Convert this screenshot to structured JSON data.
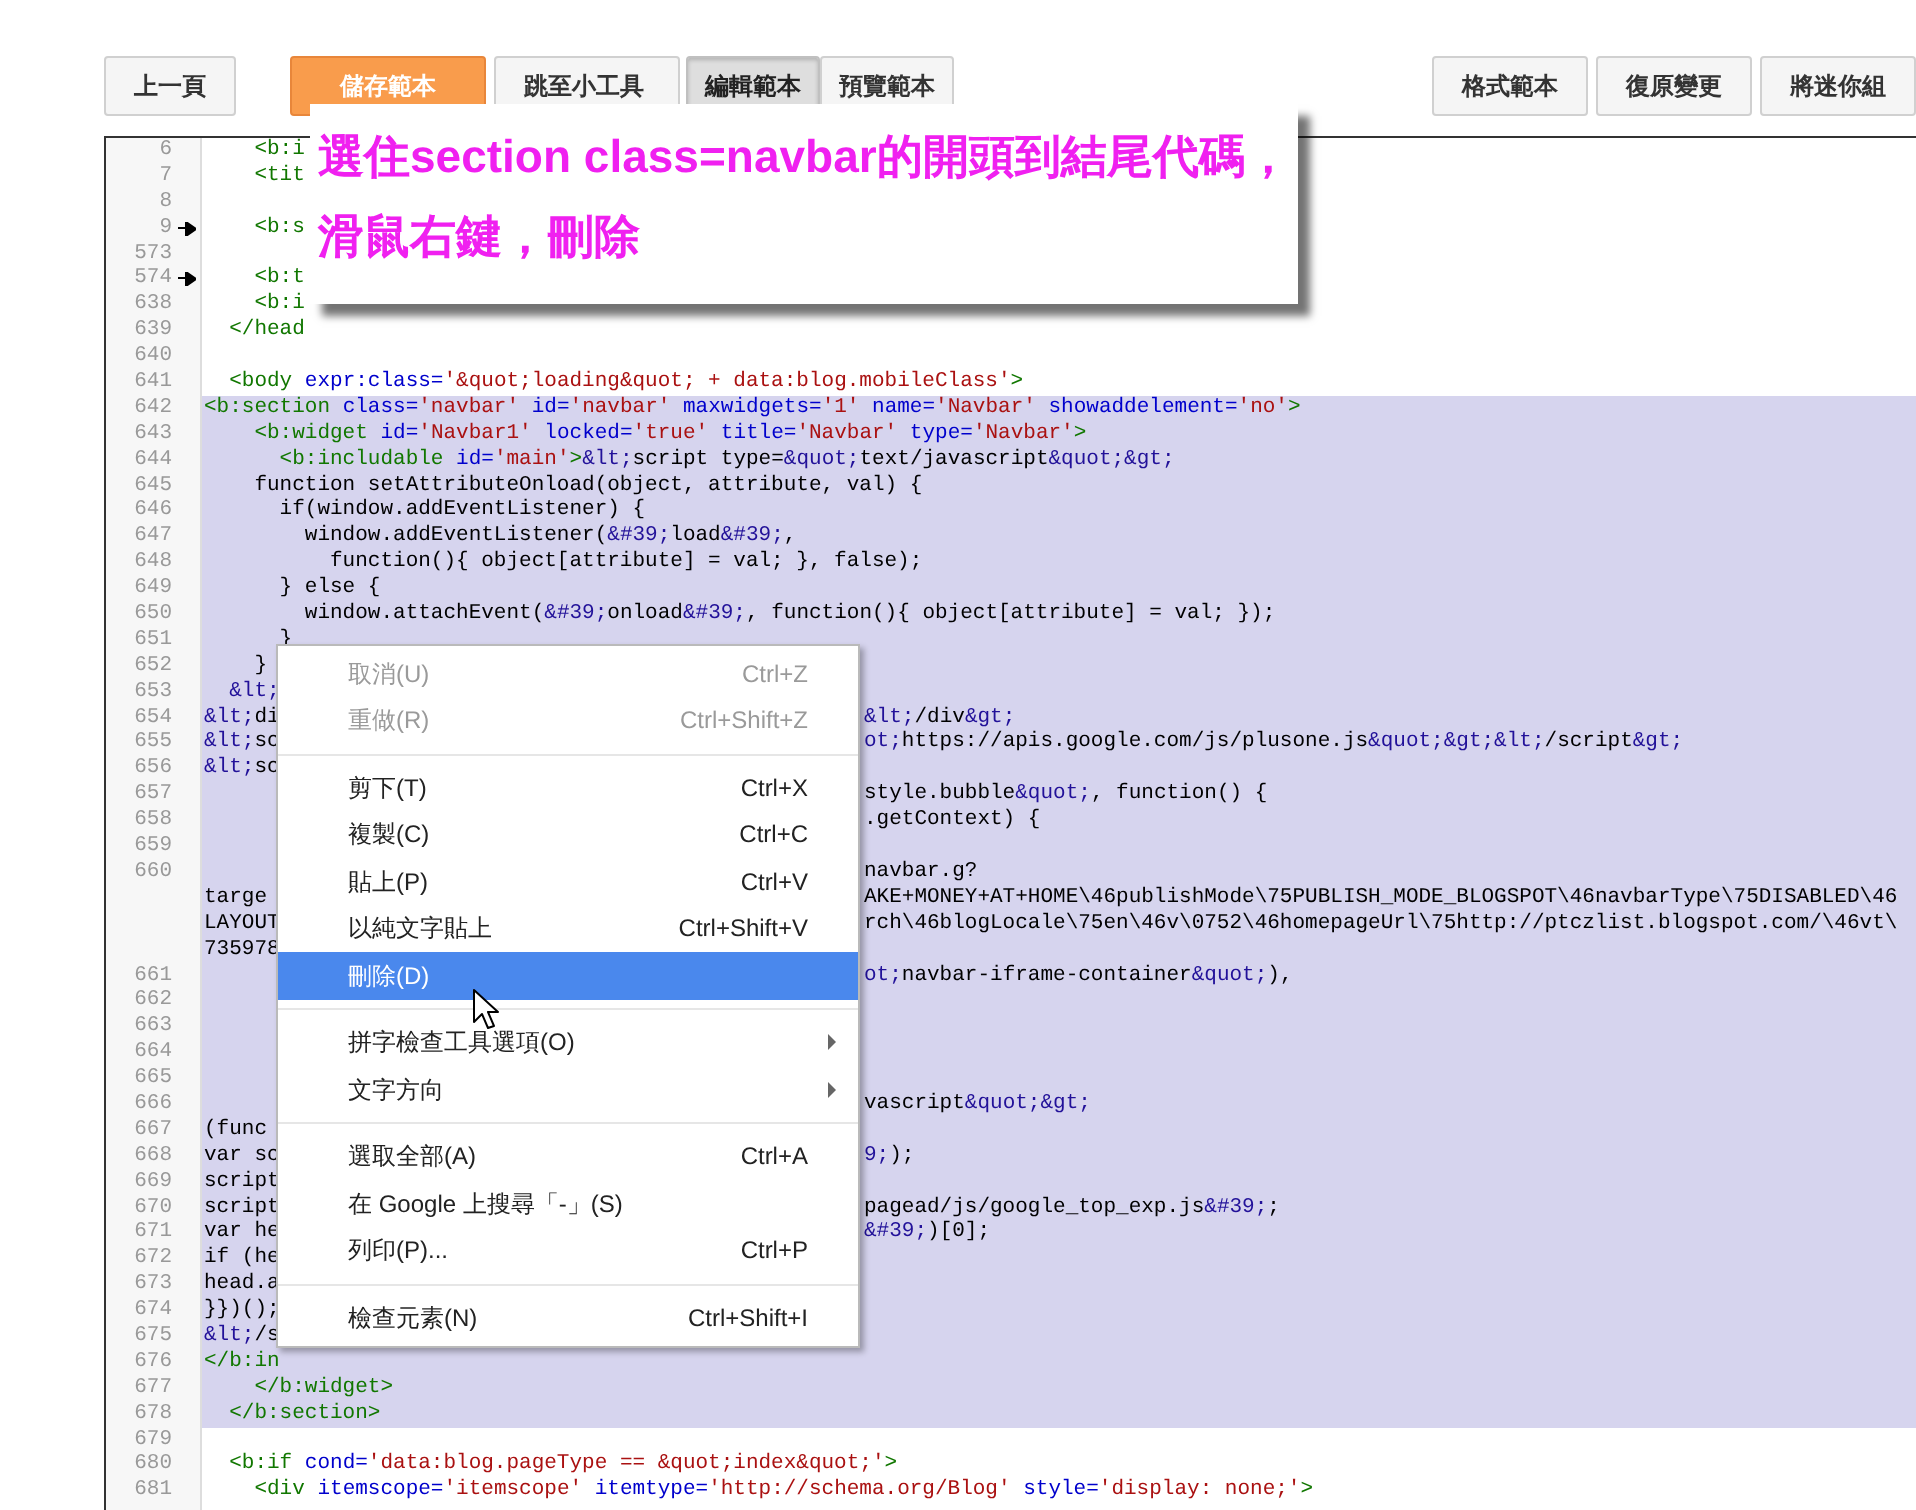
{
  "toolbar": {
    "left": [
      {
        "label": "上一頁",
        "kind": "button"
      },
      {
        "label": "儲存範本",
        "kind": "primary"
      },
      {
        "label": "跳至小工具",
        "kind": "dropdown"
      },
      {
        "label": "編輯範本",
        "kind": "tab",
        "selected": true
      },
      {
        "label": "預覽範本",
        "kind": "tab",
        "selected": false
      }
    ],
    "right": [
      {
        "label": "格式範本",
        "kind": "button"
      },
      {
        "label": "復原變更",
        "kind": "button"
      },
      {
        "label": "將迷你組",
        "kind": "button"
      }
    ]
  },
  "lines": [
    {
      "number": "6",
      "fold": false,
      "selected": false,
      "code": [
        {
          "text": "    <b:i",
          "kind": "tag"
        }
      ]
    },
    {
      "number": "7",
      "fold": false,
      "selected": false,
      "code": [
        {
          "text": "    <tit",
          "kind": "tag"
        }
      ]
    },
    {
      "number": "8",
      "fold": false,
      "selected": false
    },
    {
      "number": "9",
      "fold": true,
      "selected": false,
      "code": [
        {
          "text": "    <b:s",
          "kind": "tag"
        }
      ]
    },
    {
      "number": "573",
      "fold": false,
      "selected": false
    },
    {
      "number": "574",
      "fold": true,
      "selected": false,
      "code": [
        {
          "text": "    <b:t",
          "kind": "tag"
        }
      ]
    },
    {
      "number": "638",
      "fold": false,
      "selected": false,
      "code": [
        {
          "text": "    <b:i",
          "kind": "tag"
        }
      ]
    },
    {
      "number": "639",
      "fold": false,
      "selected": false,
      "code": [
        {
          "text": "  </head",
          "kind": "tag"
        }
      ]
    },
    {
      "number": "640",
      "fold": false,
      "selected": false
    },
    {
      "number": "641",
      "fold": false,
      "selected": false,
      "code": [
        {
          "text": "  <body",
          "kind": "tag"
        },
        {
          "text": " expr:class=",
          "kind": "attr"
        },
        {
          "text": "'&quot;loading&quot; + data:blog.mobileClass'",
          "kind": "value"
        },
        {
          "text": ">",
          "kind": "tag"
        }
      ]
    },
    {
      "number": "642",
      "fold": false,
      "selected": true,
      "code": [
        {
          "text": "<b:section",
          "kind": "tag"
        },
        {
          "text": " class=",
          "kind": "attr"
        },
        {
          "text": "'navbar'",
          "kind": "value"
        },
        {
          "text": " id=",
          "kind": "attr"
        },
        {
          "text": "'navbar'",
          "kind": "value"
        },
        {
          "text": " maxwidgets=",
          "kind": "attr"
        },
        {
          "text": "'1'",
          "kind": "value"
        },
        {
          "text": " name=",
          "kind": "attr"
        },
        {
          "text": "'Navbar'",
          "kind": "value"
        },
        {
          "text": " showaddelement=",
          "kind": "attr"
        },
        {
          "text": "'no'",
          "kind": "value"
        },
        {
          "text": ">",
          "kind": "tag"
        }
      ]
    },
    {
      "number": "643",
      "fold": false,
      "selected": true,
      "code": [
        {
          "text": "    <b:widget",
          "kind": "tag"
        },
        {
          "text": " id=",
          "kind": "attr"
        },
        {
          "text": "'Navbar1'",
          "kind": "value"
        },
        {
          "text": " locked=",
          "kind": "attr"
        },
        {
          "text": "'true'",
          "kind": "value"
        },
        {
          "text": " title=",
          "kind": "attr"
        },
        {
          "text": "'Navbar'",
          "kind": "value"
        },
        {
          "text": " type=",
          "kind": "attr"
        },
        {
          "text": "'Navbar'",
          "kind": "value"
        },
        {
          "text": ">",
          "kind": "tag"
        }
      ]
    },
    {
      "number": "644",
      "fold": false,
      "selected": true,
      "code": [
        {
          "text": "      <b:includable",
          "kind": "tag"
        },
        {
          "text": " id=",
          "kind": "attr"
        },
        {
          "text": "'main'",
          "kind": "value"
        },
        {
          "text": ">",
          "kind": "tag"
        },
        {
          "text": "&lt;",
          "kind": "entity"
        },
        {
          "text": "script type=",
          "kind": "plain"
        },
        {
          "text": "&quot;",
          "kind": "entity"
        },
        {
          "text": "text/javascript",
          "kind": "plain"
        },
        {
          "text": "&quot;&gt;",
          "kind": "entity"
        }
      ]
    },
    {
      "number": "645",
      "fold": false,
      "selected": true,
      "code": [
        {
          "text": "    function setAttributeOnload(object, attribute, val) {",
          "kind": "plain"
        }
      ]
    },
    {
      "number": "646",
      "fold": false,
      "selected": true,
      "code": [
        {
          "text": "      if(window.addEventListener) {",
          "kind": "plain"
        }
      ]
    },
    {
      "number": "647",
      "fold": false,
      "selected": true,
      "code": [
        {
          "text": "        window.addEventListener(",
          "kind": "plain"
        },
        {
          "text": "&#39;",
          "kind": "entity"
        },
        {
          "text": "load",
          "kind": "plain"
        },
        {
          "text": "&#39;",
          "kind": "entity"
        },
        {
          "text": ",",
          "kind": "plain"
        }
      ]
    },
    {
      "number": "648",
      "fold": false,
      "selected": true,
      "code": [
        {
          "text": "          function(){ object[attribute] = val; }, false);",
          "kind": "plain"
        }
      ]
    },
    {
      "number": "649",
      "fold": false,
      "selected": true,
      "code": [
        {
          "text": "      } else {",
          "kind": "plain"
        }
      ]
    },
    {
      "number": "650",
      "fold": false,
      "selected": true,
      "code": [
        {
          "text": "        window.attachEvent(",
          "kind": "plain"
        },
        {
          "text": "&#39;",
          "kind": "entity"
        },
        {
          "text": "onload",
          "kind": "plain"
        },
        {
          "text": "&#39;",
          "kind": "entity"
        },
        {
          "text": ", function(){ object[attribute] = val; });",
          "kind": "plain"
        }
      ]
    },
    {
      "number": "651",
      "fold": false,
      "selected": true,
      "code": [
        {
          "text": "      }",
          "kind": "plain"
        }
      ]
    },
    {
      "number": "652",
      "fold": false,
      "selected": true,
      "code": [
        {
          "text": "    }",
          "kind": "plain"
        }
      ]
    },
    {
      "number": "653",
      "fold": false,
      "selected": true,
      "code": [
        {
          "text": "  &lt;",
          "kind": "entity"
        }
      ]
    },
    {
      "number": "654",
      "fold": false,
      "selected": true,
      "code": [
        {
          "text": "&lt;",
          "kind": "entity"
        },
        {
          "text": "di",
          "kind": "plain"
        }
      ],
      "tail": [
        {
          "text": "&lt;",
          "kind": "entity"
        },
        {
          "text": "/div",
          "kind": "plain"
        },
        {
          "text": "&gt;",
          "kind": "entity"
        }
      ]
    },
    {
      "number": "655",
      "fold": false,
      "selected": true,
      "code": [
        {
          "text": "&lt;",
          "kind": "entity"
        },
        {
          "text": "sc",
          "kind": "plain"
        }
      ],
      "tail": [
        {
          "text": "ot;",
          "kind": "entity"
        },
        {
          "text": "https://apis.google.com/js/plusone.js",
          "kind": "plain"
        },
        {
          "text": "&quot;&gt;&lt;",
          "kind": "entity"
        },
        {
          "text": "/script",
          "kind": "plain"
        },
        {
          "text": "&gt;",
          "kind": "entity"
        }
      ]
    },
    {
      "number": "656",
      "fold": false,
      "selected": true,
      "code": [
        {
          "text": "&lt;",
          "kind": "entity"
        },
        {
          "text": "sc",
          "kind": "plain"
        }
      ]
    },
    {
      "number": "657",
      "fold": false,
      "selected": true,
      "tail": [
        {
          "text": "style.bubble",
          "kind": "plain"
        },
        {
          "text": "&quot;",
          "kind": "entity"
        },
        {
          "text": ", function() {",
          "kind": "plain"
        }
      ]
    },
    {
      "number": "658",
      "fold": false,
      "selected": true,
      "tail": [
        {
          "text": ".getContext) {",
          "kind": "plain"
        }
      ]
    },
    {
      "number": "659",
      "fold": false,
      "selected": true
    },
    {
      "number": "660",
      "fold": false,
      "selected": true,
      "tail": [
        {
          "text": "navbar.g?",
          "kind": "plain"
        }
      ]
    },
    {
      "fold": false,
      "selected": true,
      "code": [
        {
          "text": "targe",
          "kind": "plain"
        }
      ],
      "tail": [
        {
          "text": "AKE+MONEY+AT+HOME\\46publishMode\\75PUBLISH_MODE_BLOGSPOT\\46navbarType\\75DISABLED\\46",
          "kind": "plain"
        }
      ]
    },
    {
      "fold": false,
      "selected": true,
      "code": [
        {
          "text": "LAYOUT",
          "kind": "plain"
        }
      ],
      "tail": [
        {
          "text": "rch\\46blogLocale\\75en\\46v\\0752\\46homepageUrl\\75http://ptczlist.blogspot.com/\\46vt\\",
          "kind": "plain"
        }
      ]
    },
    {
      "fold": false,
      "selected": true,
      "code": [
        {
          "text": "735978",
          "kind": "plain"
        }
      ]
    },
    {
      "number": "661",
      "fold": false,
      "selected": true,
      "tail": [
        {
          "text": "ot;",
          "kind": "entity"
        },
        {
          "text": "navbar-iframe-container",
          "kind": "plain"
        },
        {
          "text": "&quot;",
          "kind": "entity"
        },
        {
          "text": "),",
          "kind": "plain"
        }
      ]
    },
    {
      "number": "662",
      "fold": false,
      "selected": true
    },
    {
      "number": "663",
      "fold": false,
      "selected": true
    },
    {
      "number": "664",
      "fold": false,
      "selected": true
    },
    {
      "number": "665",
      "fold": false,
      "selected": true
    },
    {
      "number": "666",
      "fold": false,
      "selected": true,
      "tail": [
        {
          "text": "vascript",
          "kind": "plain"
        },
        {
          "text": "&quot;&gt;",
          "kind": "entity"
        }
      ]
    },
    {
      "number": "667",
      "fold": false,
      "selected": true,
      "code": [
        {
          "text": "(func",
          "kind": "plain"
        }
      ]
    },
    {
      "number": "668",
      "fold": false,
      "selected": true,
      "code": [
        {
          "text": "var sc",
          "kind": "plain"
        }
      ],
      "tail": [
        {
          "text": "9;",
          "kind": "entity"
        },
        {
          "text": ");",
          "kind": "plain"
        }
      ]
    },
    {
      "number": "669",
      "fold": false,
      "selected": true,
      "code": [
        {
          "text": "script",
          "kind": "plain"
        }
      ]
    },
    {
      "number": "670",
      "fold": false,
      "selected": true,
      "code": [
        {
          "text": "script",
          "kind": "plain"
        }
      ],
      "tail": [
        {
          "text": "pagead/js/google_top_exp.js",
          "kind": "plain"
        },
        {
          "text": "&#39;",
          "kind": "entity"
        },
        {
          "text": ";",
          "kind": "plain"
        }
      ]
    },
    {
      "number": "671",
      "fold": false,
      "selected": true,
      "code": [
        {
          "text": "var he",
          "kind": "plain"
        }
      ],
      "tail": [
        {
          "text": "&#39;",
          "kind": "entity"
        },
        {
          "text": ")[0];",
          "kind": "plain"
        }
      ]
    },
    {
      "number": "672",
      "fold": false,
      "selected": true,
      "code": [
        {
          "text": "if (he",
          "kind": "plain"
        }
      ]
    },
    {
      "number": "673",
      "fold": false,
      "selected": true,
      "code": [
        {
          "text": "head.a",
          "kind": "plain"
        }
      ]
    },
    {
      "number": "674",
      "fold": false,
      "selected": true,
      "code": [
        {
          "text": "}})();",
          "kind": "plain"
        }
      ]
    },
    {
      "number": "675",
      "fold": false,
      "selected": true,
      "code": [
        {
          "text": "&lt;",
          "kind": "entity"
        },
        {
          "text": "/s",
          "kind": "plain"
        }
      ]
    },
    {
      "number": "676",
      "fold": false,
      "selected": true,
      "code": [
        {
          "text": "</b:in",
          "kind": "tag"
        }
      ]
    },
    {
      "number": "677",
      "fold": false,
      "selected": true,
      "code": [
        {
          "text": "    </b:widget>",
          "kind": "tag"
        }
      ]
    },
    {
      "number": "678",
      "fold": false,
      "selected": true,
      "code": [
        {
          "text": "  </b:section>",
          "kind": "tag"
        }
      ]
    },
    {
      "number": "679",
      "fold": false,
      "selected": false
    },
    {
      "number": "680",
      "fold": false,
      "selected": false,
      "code": [
        {
          "text": "  <b:if",
          "kind": "tag"
        },
        {
          "text": " cond=",
          "kind": "attr"
        },
        {
          "text": "'data:blog.pageType == &quot;index&quot;'",
          "kind": "value"
        },
        {
          "text": ">",
          "kind": "tag"
        }
      ]
    },
    {
      "number": "681",
      "fold": false,
      "selected": false,
      "code": [
        {
          "text": "    <div",
          "kind": "tag"
        },
        {
          "text": " itemscope=",
          "kind": "attr"
        },
        {
          "text": "'itemscope'",
          "kind": "value"
        },
        {
          "text": " itemtype=",
          "kind": "attr"
        },
        {
          "text": "'http://schema.org/Blog'",
          "kind": "value"
        },
        {
          "text": " style=",
          "kind": "attr"
        },
        {
          "text": "'display: none;'",
          "kind": "value"
        },
        {
          "text": ">",
          "kind": "tag"
        }
      ]
    }
  ],
  "context_menu": {
    "items": [
      {
        "kind": "item",
        "label": "取消(U)",
        "shortcut": "Ctrl+Z",
        "disabled": true,
        "selected": false,
        "submenu": false
      },
      {
        "kind": "item",
        "label": "重做(R)",
        "shortcut": "Ctrl+Shift+Z",
        "disabled": true,
        "selected": false,
        "submenu": false
      },
      {
        "kind": "separator"
      },
      {
        "kind": "item",
        "label": "剪下(T)",
        "shortcut": "Ctrl+X",
        "disabled": false,
        "selected": false,
        "submenu": false
      },
      {
        "kind": "item",
        "label": "複製(C)",
        "shortcut": "Ctrl+C",
        "disabled": false,
        "selected": false,
        "submenu": false
      },
      {
        "kind": "item",
        "label": "貼上(P)",
        "shortcut": "Ctrl+V",
        "disabled": false,
        "selected": false,
        "submenu": false
      },
      {
        "kind": "item",
        "label": "以純文字貼上",
        "shortcut": "Ctrl+Shift+V",
        "disabled": false,
        "selected": false,
        "submenu": false
      },
      {
        "kind": "item",
        "label": "刪除(D)",
        "disabled": false,
        "selected": true,
        "submenu": false
      },
      {
        "kind": "separator"
      },
      {
        "kind": "item",
        "label": "拼字檢查工具選項(O)",
        "disabled": false,
        "selected": false,
        "submenu": true
      },
      {
        "kind": "item",
        "label": "文字方向",
        "disabled": false,
        "selected": false,
        "submenu": true
      },
      {
        "kind": "separator"
      },
      {
        "kind": "item",
        "label": "選取全部(A)",
        "shortcut": "Ctrl+A",
        "disabled": false,
        "selected": false,
        "submenu": false
      },
      {
        "kind": "item",
        "label": "在 Google 上搜尋「-」(S)",
        "disabled": false,
        "selected": false,
        "submenu": false
      },
      {
        "kind": "item",
        "label": "列印(P)...",
        "shortcut": "Ctrl+P",
        "disabled": false,
        "selected": false,
        "submenu": false
      },
      {
        "kind": "separator"
      },
      {
        "kind": "item",
        "label": "檢查元素(N)",
        "shortcut": "Ctrl+Shift+I",
        "disabled": false,
        "selected": false,
        "submenu": false
      }
    ]
  },
  "callout": {
    "lines": [
      "選住section class=navbar的開頭到結尾代碼，",
      "滑鼠右鍵，刪除"
    ]
  }
}
